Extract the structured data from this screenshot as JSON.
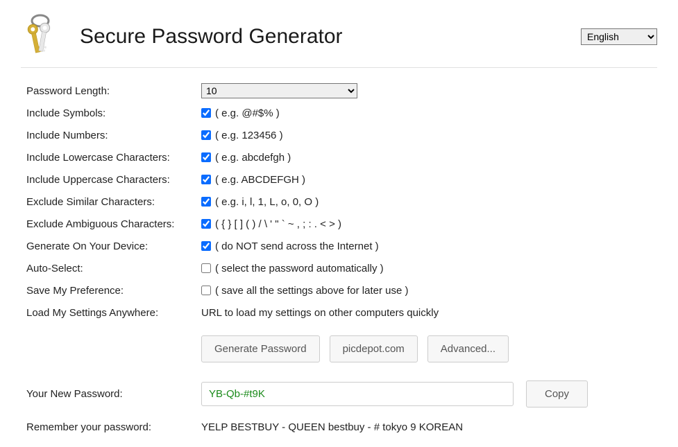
{
  "header": {
    "title": "Secure Password Generator",
    "language": "English"
  },
  "form": {
    "length_label": "Password Length:",
    "length_value": "10",
    "symbols_label": "Include Symbols:",
    "symbols_hint": "( e.g. @#$% )",
    "symbols_checked": true,
    "numbers_label": "Include Numbers:",
    "numbers_hint": "( e.g. 123456 )",
    "numbers_checked": true,
    "lowercase_label": "Include Lowercase Characters:",
    "lowercase_hint": "( e.g. abcdefgh )",
    "lowercase_checked": true,
    "uppercase_label": "Include Uppercase Characters:",
    "uppercase_hint": "( e.g. ABCDEFGH )",
    "uppercase_checked": true,
    "similar_label": "Exclude Similar Characters:",
    "similar_hint": "( e.g. i, l, 1, L, o, 0, O )",
    "similar_checked": true,
    "ambiguous_label": "Exclude Ambiguous Characters:",
    "ambiguous_hint": "( { } [ ] ( ) / \\ ' \" ` ~ , ; : . < > )",
    "ambiguous_checked": true,
    "device_label": "Generate On Your Device:",
    "device_hint": "( do NOT send across the Internet )",
    "device_checked": true,
    "autoselect_label": "Auto-Select:",
    "autoselect_hint": "( select the password automatically )",
    "autoselect_checked": false,
    "savepref_label": "Save My Preference:",
    "savepref_hint": "( save all the settings above for later use )",
    "savepref_checked": false,
    "loadsettings_label": "Load My Settings Anywhere:",
    "loadsettings_hint": "URL to load my settings on other computers quickly"
  },
  "buttons": {
    "generate": "Generate Password",
    "picdepot": "picdepot.com",
    "advanced": "Advanced...",
    "copy": "Copy"
  },
  "result": {
    "label": "Your New Password:",
    "value": "YB-Qb-#t9K",
    "remember_label": "Remember your password:",
    "remember_value": "YELP BESTBUY - QUEEN bestbuy - # tokyo 9 KOREAN"
  }
}
